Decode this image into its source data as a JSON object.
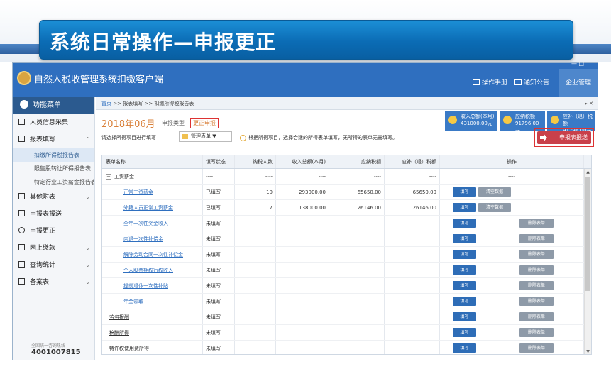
{
  "slide": {
    "title": "系统日常操作—申报更正"
  },
  "app": {
    "title": "自然人税收管理系统扣缴客户端",
    "header_links": [
      "操作手册",
      "通知公告"
    ],
    "header_button": "企业管理",
    "window_controls": "— □"
  },
  "sidebar": {
    "head": "功能菜单",
    "items": [
      {
        "label": "人员信息采集",
        "icon": "person-icon"
      },
      {
        "label": "报表填写",
        "icon": "form-icon"
      },
      {
        "label": "其他附表",
        "icon": "attachment-icon"
      },
      {
        "label": "申报表报送",
        "icon": "grid-icon"
      },
      {
        "label": "申报更正",
        "icon": "search-icon"
      },
      {
        "label": "网上缴款",
        "icon": "payment-icon"
      },
      {
        "label": "查询统计",
        "icon": "stats-icon"
      },
      {
        "label": "备案表",
        "icon": "record-icon"
      }
    ],
    "subitems": [
      "扣缴所得税报告表",
      "限售股转让所得报告表",
      "特定行业工资薪金报告表"
    ],
    "hotline_label": "全国统一咨询热线",
    "hotline": "4001007815"
  },
  "breadcrumb": {
    "home": "首页",
    "path": ">> 报表填写 >> 扣缴所得税报告表",
    "controls": "▸ ✕"
  },
  "period": {
    "label": "2018年06月",
    "type_label": "申报类型",
    "type_value": "更正申报"
  },
  "stats": [
    {
      "label": "收入总额(本月)",
      "value": "431000.00元"
    },
    {
      "label": "应纳税额",
      "value": "91796.00元"
    },
    {
      "label": "应补（退）税额",
      "value": "91796.00元"
    }
  ],
  "filter": {
    "label": "请选择所得项目进行填写",
    "select_value": "管理表单 ▼",
    "tip": "根据所得项目，选择合适的所得表单填写，无所得的表单无需填写。"
  },
  "submit_button": "申报表报送",
  "table": {
    "headers": [
      "表单名称",
      "填写状态",
      "纳税人数",
      "收入总额(本月)",
      "应纳税额",
      "应补（退）税额",
      "操作"
    ],
    "rows": [
      {
        "name": "工资薪金",
        "status": "----",
        "count": "----",
        "income": "----",
        "tax": "----",
        "refund": "----",
        "ops": "----",
        "type": "group"
      },
      {
        "name": "正常工资薪金",
        "status": "已填写",
        "count": "10",
        "income": "293000.00",
        "tax": "65650.00",
        "refund": "65650.00",
        "type": "filled"
      },
      {
        "name": "外籍人员正常工资薪金",
        "status": "已填写",
        "count": "7",
        "income": "138000.00",
        "tax": "26146.00",
        "refund": "26146.00",
        "type": "filled"
      },
      {
        "name": "全年一次性奖金收入",
        "status": "未填写",
        "type": "empty"
      },
      {
        "name": "内退一次性补偿金",
        "status": "未填写",
        "type": "empty"
      },
      {
        "name": "解除劳动合同一次性补偿金",
        "status": "未填写",
        "type": "empty"
      },
      {
        "name": "个人股票期权行权收入",
        "status": "未填写",
        "type": "empty"
      },
      {
        "name": "提前退休一次性补贴",
        "status": "未填写",
        "type": "empty"
      },
      {
        "name": "年金领取",
        "status": "未填写",
        "type": "empty"
      },
      {
        "name": "劳务报酬",
        "status": "未填写",
        "type": "top"
      },
      {
        "name": "稿酬所得",
        "status": "未填写",
        "type": "top"
      },
      {
        "name": "特许权使用费所得",
        "status": "未填写",
        "type": "top"
      }
    ],
    "buttons": {
      "fill": "填写",
      "clear": "清空数据",
      "delete": "删除表单"
    }
  }
}
